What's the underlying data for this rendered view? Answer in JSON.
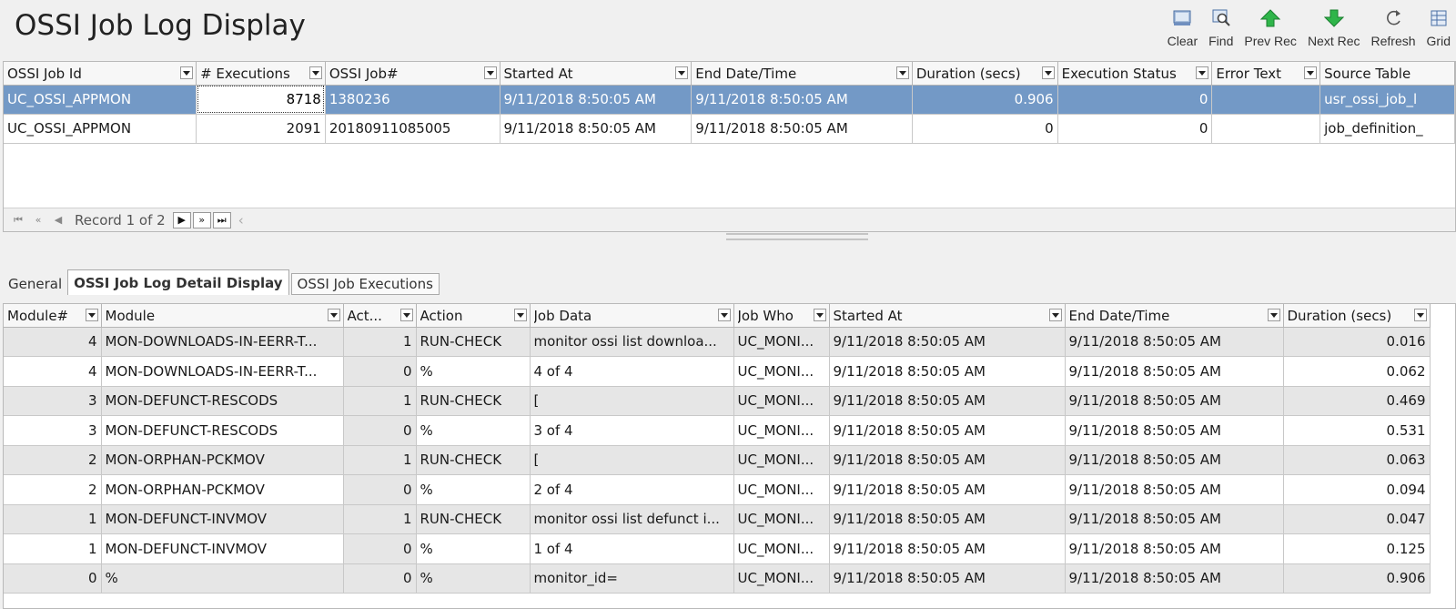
{
  "page": {
    "title": "OSSI Job Log Display"
  },
  "toolbar": {
    "buttons": [
      {
        "label": "Clear",
        "icon": "clear-icon"
      },
      {
        "label": "Find",
        "icon": "find-icon"
      },
      {
        "label": "Prev Rec",
        "icon": "up-arrow-icon"
      },
      {
        "label": "Next Rec",
        "icon": "down-arrow-icon"
      },
      {
        "label": "Refresh",
        "icon": "refresh-icon"
      },
      {
        "label": "Grid",
        "icon": "grid-icon"
      }
    ],
    "colors": {
      "arrow": "#22a83a",
      "blue": "#4a6fa5"
    }
  },
  "top_grid": {
    "columns": [
      "OSSI Job Id",
      "# Executions",
      "OSSI Job#",
      "Started At",
      "End Date/Time",
      "Duration (secs)",
      "Execution Status",
      "Error Text",
      "Source Table"
    ],
    "rows": [
      [
        "UC_OSSI_APPMON",
        "8718",
        "1380236",
        "9/11/2018 8:50:05 AM",
        "9/11/2018 8:50:05 AM",
        "0.906",
        "0",
        "",
        "usr_ossi_job_l"
      ],
      [
        "UC_OSSI_APPMON",
        "2091",
        "20180911085005",
        "9/11/2018 8:50:05 AM",
        "9/11/2018 8:50:05 AM",
        "0",
        "0",
        "",
        "job_definition_"
      ]
    ],
    "selected_color": "#7399c6"
  },
  "pager": {
    "record_text": "Record 1 of 2"
  },
  "tabs": [
    "General",
    "OSSI Job Log Detail Display",
    "OSSI Job Executions"
  ],
  "bottom_grid": {
    "columns": [
      "Module#",
      "Module",
      "Act...",
      "Action",
      "Job Data",
      "Job Who",
      "Started At",
      "End Date/Time",
      "Duration (secs)"
    ],
    "rows": [
      [
        "4",
        "MON-DOWNLOADS-IN-EERR-T...",
        "1",
        "RUN-CHECK",
        "monitor ossi list downloa...",
        "UC_MONI...",
        "9/11/2018 8:50:05 AM",
        "9/11/2018 8:50:05 AM",
        "0.016"
      ],
      [
        "4",
        "MON-DOWNLOADS-IN-EERR-T...",
        "0",
        "%",
        "4 of 4",
        "UC_MONI...",
        "9/11/2018 8:50:05 AM",
        "9/11/2018 8:50:05 AM",
        "0.062"
      ],
      [
        "3",
        "MON-DEFUNCT-RESCODS",
        "1",
        "RUN-CHECK",
        "[",
        "UC_MONI...",
        "9/11/2018 8:50:05 AM",
        "9/11/2018 8:50:05 AM",
        "0.469"
      ],
      [
        "3",
        "MON-DEFUNCT-RESCODS",
        "0",
        "%",
        "3 of 4",
        "UC_MONI...",
        "9/11/2018 8:50:05 AM",
        "9/11/2018 8:50:05 AM",
        "0.531"
      ],
      [
        "2",
        "MON-ORPHAN-PCKMOV",
        "1",
        "RUN-CHECK",
        "[",
        "UC_MONI...",
        "9/11/2018 8:50:05 AM",
        "9/11/2018 8:50:05 AM",
        "0.063"
      ],
      [
        "2",
        "MON-ORPHAN-PCKMOV",
        "0",
        "%",
        "2 of 4",
        "UC_MONI...",
        "9/11/2018 8:50:05 AM",
        "9/11/2018 8:50:05 AM",
        "0.094"
      ],
      [
        "1",
        "MON-DEFUNCT-INVMOV",
        "1",
        "RUN-CHECK",
        "monitor ossi list defunct i...",
        "UC_MONI...",
        "9/11/2018 8:50:05 AM",
        "9/11/2018 8:50:05 AM",
        "0.047"
      ],
      [
        "1",
        "MON-DEFUNCT-INVMOV",
        "0",
        "%",
        "1 of 4",
        "UC_MONI...",
        "9/11/2018 8:50:05 AM",
        "9/11/2018 8:50:05 AM",
        "0.125"
      ],
      [
        "0",
        "%",
        "0",
        "%",
        "monitor_id=",
        "UC_MONI...",
        "9/11/2018 8:50:05 AM",
        "9/11/2018 8:50:05 AM",
        "0.906"
      ]
    ]
  }
}
